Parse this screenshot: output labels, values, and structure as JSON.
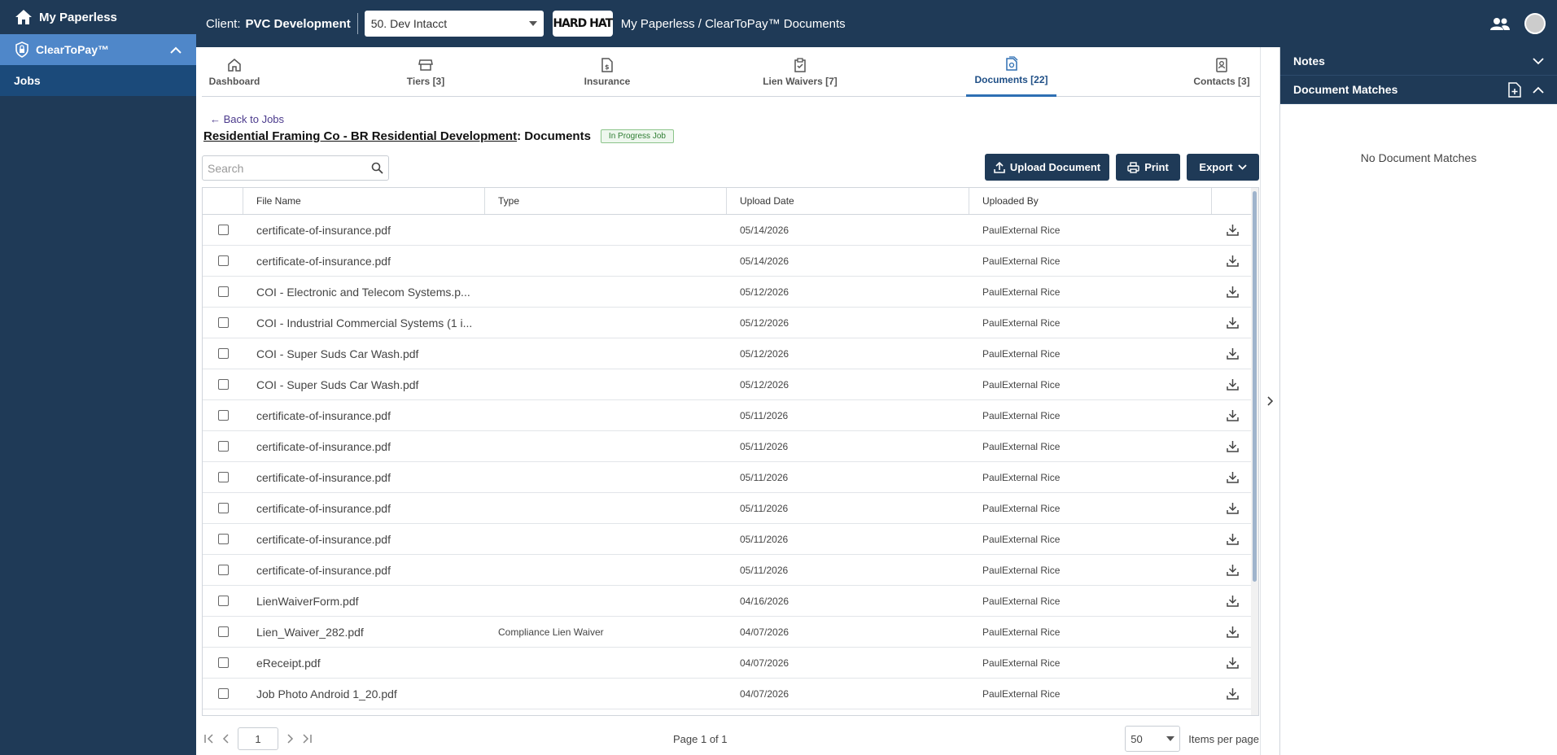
{
  "sidebar": {
    "brand": "My Paperless",
    "module": "ClearToPay™",
    "nav_item": "Jobs"
  },
  "topbar": {
    "client_label": "Client:",
    "client_name": "PVC Development",
    "entity_select": "50. Dev Intacct",
    "logo_text": "HARD HAT",
    "breadcrumb": "My Paperless  /  ClearToPay™ Documents"
  },
  "tabs": [
    {
      "label": "Dashboard",
      "icon": "home-icon"
    },
    {
      "label": "Tiers [3]",
      "icon": "store-icon"
    },
    {
      "label": "Insurance",
      "icon": "invoice-icon"
    },
    {
      "label": "Lien Waivers [7]",
      "icon": "clipboard-check-icon"
    },
    {
      "label": "Documents [22]",
      "icon": "documents-icon"
    },
    {
      "label": "Contacts [3]",
      "icon": "contact-book-icon"
    }
  ],
  "page": {
    "back_link": "← Back to Jobs",
    "job_name": "Residential Framing Co - BR Residential Development",
    "section": ": Documents",
    "status_badge": "In Progress Job",
    "search_placeholder": "Search"
  },
  "toolbar": {
    "upload": "Upload Document",
    "print": "Print",
    "export": "Export"
  },
  "table": {
    "columns": [
      "File Name",
      "Type",
      "Upload Date",
      "Uploaded By"
    ],
    "rows": [
      {
        "file": "certificate-of-insurance.pdf",
        "type": "",
        "date": "05/14/2026",
        "by": "PaulExternal Rice"
      },
      {
        "file": "certificate-of-insurance.pdf",
        "type": "",
        "date": "05/14/2026",
        "by": "PaulExternal Rice"
      },
      {
        "file": "COI - Electronic and Telecom Systems.p...",
        "type": "",
        "date": "05/12/2026",
        "by": "PaulExternal Rice"
      },
      {
        "file": "COI - Industrial Commercial Systems (1 i...",
        "type": "",
        "date": "05/12/2026",
        "by": "PaulExternal Rice"
      },
      {
        "file": "COI - Super Suds Car Wash.pdf",
        "type": "",
        "date": "05/12/2026",
        "by": "PaulExternal Rice"
      },
      {
        "file": "COI - Super Suds Car Wash.pdf",
        "type": "",
        "date": "05/12/2026",
        "by": "PaulExternal Rice"
      },
      {
        "file": "certificate-of-insurance.pdf",
        "type": "",
        "date": "05/11/2026",
        "by": "PaulExternal Rice"
      },
      {
        "file": "certificate-of-insurance.pdf",
        "type": "",
        "date": "05/11/2026",
        "by": "PaulExternal Rice"
      },
      {
        "file": "certificate-of-insurance.pdf",
        "type": "",
        "date": "05/11/2026",
        "by": "PaulExternal Rice"
      },
      {
        "file": "certificate-of-insurance.pdf",
        "type": "",
        "date": "05/11/2026",
        "by": "PaulExternal Rice"
      },
      {
        "file": "certificate-of-insurance.pdf",
        "type": "",
        "date": "05/11/2026",
        "by": "PaulExternal Rice"
      },
      {
        "file": "certificate-of-insurance.pdf",
        "type": "",
        "date": "05/11/2026",
        "by": "PaulExternal Rice"
      },
      {
        "file": "LienWaiverForm.pdf",
        "type": "",
        "date": "04/16/2026",
        "by": "PaulExternal Rice"
      },
      {
        "file": "Lien_Waiver_282.pdf",
        "type": "Compliance Lien Waiver",
        "date": "04/07/2026",
        "by": "PaulExternal Rice"
      },
      {
        "file": "eReceipt.pdf",
        "type": "",
        "date": "04/07/2026",
        "by": "PaulExternal Rice"
      },
      {
        "file": "Job Photo Android 1_20.pdf",
        "type": "",
        "date": "04/07/2026",
        "by": "PaulExternal Rice"
      }
    ]
  },
  "pager": {
    "page_value": "1",
    "page_status": "Page 1 of 1",
    "per_page": "50",
    "per_page_label": "Items per page"
  },
  "right_panel": {
    "notes": "Notes",
    "matches": "Document Matches",
    "empty": "No Document Matches"
  }
}
